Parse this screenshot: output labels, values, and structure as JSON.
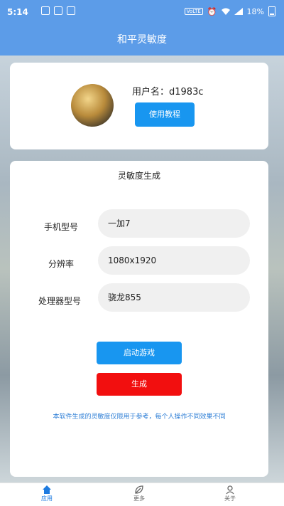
{
  "status_bar": {
    "time": "5:14",
    "network_chip": "VoLTE",
    "battery": "18%",
    "icons": [
      "notification-icon",
      "message-icon",
      "app-icon",
      "alarm-icon",
      "wifi-icon",
      "signal-icon",
      "battery-icon"
    ]
  },
  "app_bar": {
    "title": "和平灵敏度"
  },
  "user": {
    "username": "用户名：d1983c",
    "tutorial_label": "使用教程"
  },
  "generator": {
    "title": "灵敏度生成",
    "fields": [
      {
        "label": "手机型号",
        "value": "一加7"
      },
      {
        "label": "分辨率",
        "value": "1080x1920"
      },
      {
        "label": "处理器型号",
        "value": "骁龙855"
      }
    ],
    "launch_label": "启动游戏",
    "generate_label": "生成",
    "disclaimer": "本软件生成的灵敏度仅限用于参考，每个人操作不同效果不同"
  },
  "bottom_nav": {
    "items": [
      {
        "label": "应用",
        "icon": "home-icon",
        "active": true
      },
      {
        "label": "更多",
        "icon": "leaf-icon",
        "active": false
      },
      {
        "label": "关于",
        "icon": "person-icon",
        "active": false
      }
    ]
  },
  "colors": {
    "accent": "#5c9ce8",
    "primary_button": "#1896f0",
    "danger_button": "#f20f0f",
    "disclaimer_text": "#2f7fd6"
  }
}
